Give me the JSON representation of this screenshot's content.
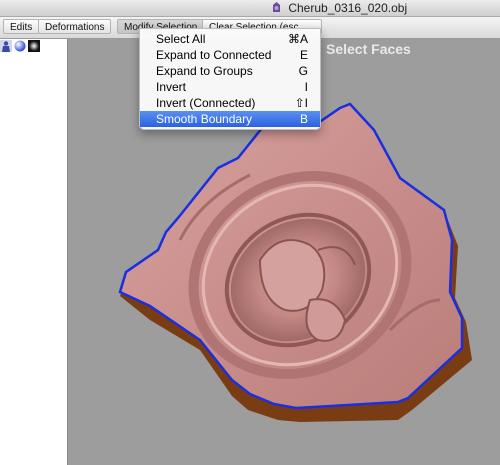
{
  "window": {
    "title": "Cherub_0316_020.obj",
    "title_icon": "document-icon"
  },
  "menubar": {
    "items": [
      {
        "label": "Edits"
      },
      {
        "label": "Deformations"
      },
      {
        "label": "Modify Selection"
      },
      {
        "label": "Clear Selection (esc"
      }
    ]
  },
  "toolbar": {
    "icons": [
      "figure-icon",
      "sphere-icon",
      "lighting-icon"
    ]
  },
  "viewport": {
    "mode_label": "Select Faces"
  },
  "dropdown": {
    "items": [
      {
        "label": "Select All",
        "shortcut": "⌘A"
      },
      {
        "label": "Expand to Connected",
        "shortcut": "E"
      },
      {
        "label": "Expand to Groups",
        "shortcut": "G"
      },
      {
        "label": "Invert",
        "shortcut": "I"
      },
      {
        "label": "Invert (Connected)",
        "shortcut": "⇧I"
      },
      {
        "label": "Smooth Boundary",
        "shortcut": "B",
        "selected": true
      }
    ]
  },
  "colors": {
    "mesh_top": "#c98e8b",
    "mesh_side": "#7a3c13",
    "selection_boundary": "#1a2fe0",
    "highlight": "#2a62e0"
  }
}
